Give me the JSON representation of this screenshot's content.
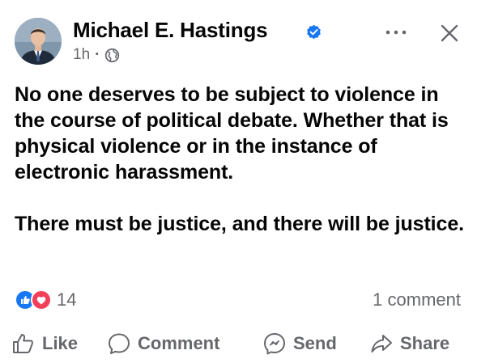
{
  "post": {
    "author": "Michael E. Hastings",
    "time": "1h",
    "separator": "·",
    "paragraphs": [
      "No one deserves to be subject to violence in the course of political debate. Whether that is physical violence or in the instance of electronic harassment.",
      "There must be justice, and there will be justice."
    ],
    "reaction_count": "14",
    "reactions": [
      "like-icon",
      "love-icon"
    ],
    "comment_count": "1 comment"
  },
  "actions": {
    "like": "Like",
    "comment": "Comment",
    "send": "Send",
    "share": "Share"
  },
  "colors": {
    "verified": "#1877f2",
    "like": "#1877f2",
    "love": "#f33e58",
    "muted": "#65676b",
    "text": "#050505"
  }
}
